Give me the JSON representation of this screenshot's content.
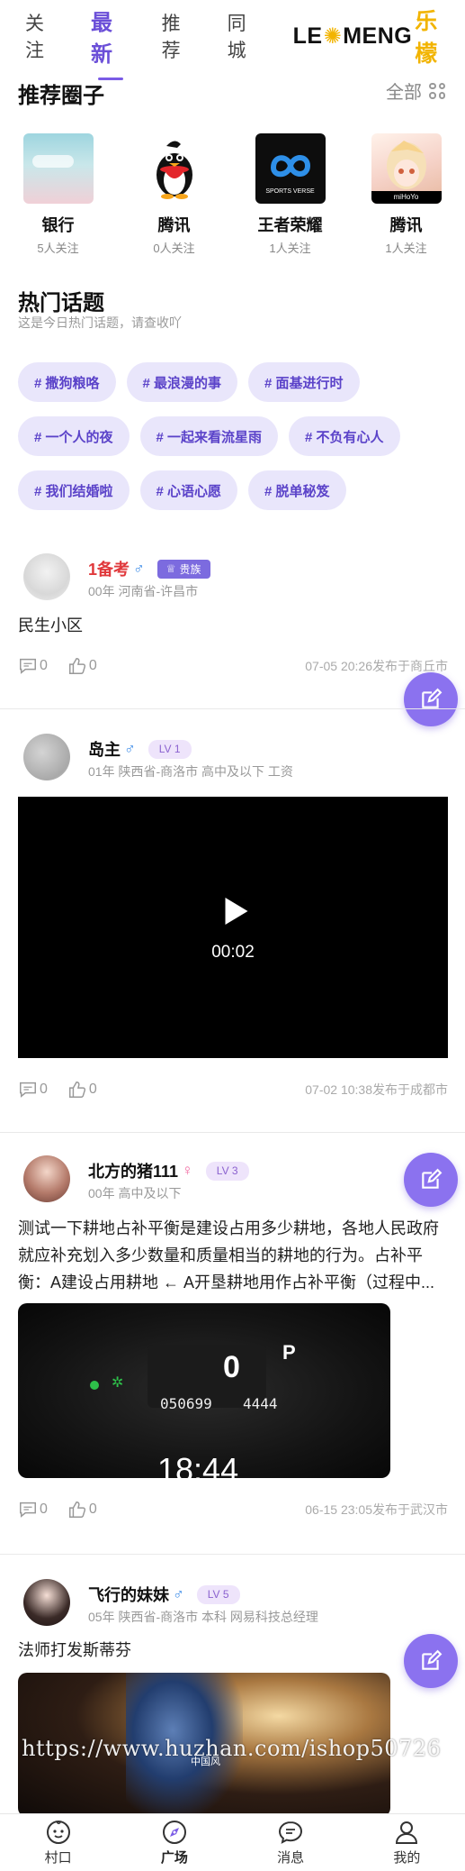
{
  "top_tabs": [
    {
      "label": "关注"
    },
    {
      "label": "最新"
    },
    {
      "label": "推荐"
    },
    {
      "label": "同城"
    }
  ],
  "active_tab": "最新",
  "brand": {
    "latin_a": "LE",
    "latin_b": "MENG",
    "chinese": "乐檬"
  },
  "circles_section": {
    "title": "推荐圈子",
    "all_label": "全部"
  },
  "circles": [
    {
      "name": "银行",
      "followers": "5人关注"
    },
    {
      "name": "腾讯",
      "followers": "0人关注"
    },
    {
      "name": "王者荣耀",
      "followers": "1人关注",
      "thumb_text": "SPORTS VERSE"
    },
    {
      "name": "腾讯",
      "followers": "1人关注",
      "thumb_text": "miHoYo"
    }
  ],
  "hot_topics": {
    "title": "热门话题",
    "subtitle": "这是今日热门话题，请查收吖",
    "rows": [
      [
        "# 撒狗粮咯",
        "# 最浪漫的事",
        "# 面基进行时"
      ],
      [
        "# 一个人的夜",
        "# 一起来看流星雨",
        "# 不负有心人"
      ],
      [
        "# 我们结婚啦",
        "# 心语心愿",
        "# 脱单秘笈"
      ]
    ]
  },
  "posts": [
    {
      "user": "1备考",
      "gender": "♂",
      "badge": "贵族",
      "meta": "00年 河南省-许昌市",
      "text": "民生小区",
      "comments": "0",
      "likes": "0",
      "time": "07-05 20:26发布于商丘市"
    },
    {
      "user": "岛主",
      "gender": "♂",
      "level": "LV 1",
      "meta": "01年 陕西省-商洛市 高中及以下 工资",
      "video_duration": "00:02",
      "comments": "0",
      "likes": "0",
      "time": "07-02 10:38发布于成都市"
    },
    {
      "user": "北方的猪111",
      "gender": "♀",
      "level": "LV 3",
      "meta": "00年 高中及以下",
      "text": "测试一下耕地占补平衡是建设占用多少耕地，各地人民政府就应补充划入多少数量和质量相当的耕地的行为。占补平衡：A建设占用耕地 ← A开垦耕地用作占补平衡（过程中...",
      "photo": {
        "speed": "0",
        "gear": "P",
        "odometer": "050699",
        "range": "4444",
        "clock": "18:44"
      },
      "comments": "0",
      "likes": "0",
      "time": "06-15 23:05发布于武汉市"
    },
    {
      "user": "飞行的妹妹",
      "gender": "♂",
      "level": "LV 5",
      "meta": "05年 陕西省-商洛市 本科 网易科技总经理",
      "text": "法师打发斯蒂芬",
      "photo_mark": "中国风"
    }
  ],
  "watermark": "https://www.huzhan.com/ishop50726",
  "bottom_nav": [
    {
      "label": "村口",
      "icon": "baby-face-icon"
    },
    {
      "label": "广场",
      "icon": "compass-icon"
    },
    {
      "label": "消息",
      "icon": "chat-bubble-icon"
    },
    {
      "label": "我的",
      "icon": "person-icon"
    }
  ],
  "colors": {
    "accent": "#7a5be6",
    "tag_bg": "#e9e6fb",
    "fab": "#8b72ef",
    "username_red": "#e0383b"
  }
}
